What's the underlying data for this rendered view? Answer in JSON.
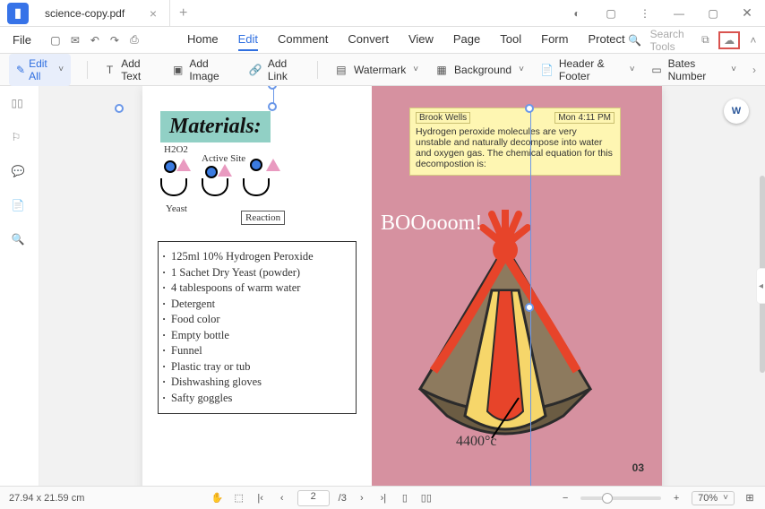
{
  "app": {
    "tab_name": "science-copy.pdf"
  },
  "menubar": {
    "file": "File",
    "items": [
      "Home",
      "Edit",
      "Comment",
      "Convert",
      "View",
      "Page",
      "Tool",
      "Form",
      "Protect"
    ],
    "active": "Edit",
    "search_placeholder": "Search Tools"
  },
  "toolbar": {
    "edit_all": "Edit All",
    "add_text": "Add Text",
    "add_image": "Add Image",
    "add_link": "Add Link",
    "watermark": "Watermark",
    "background": "Background",
    "header_footer": "Header & Footer",
    "bates_number": "Bates Number"
  },
  "document": {
    "materials_heading": "Materials:",
    "diagram": {
      "h2o2": "H2O2",
      "active_site": "Active Site",
      "yeast": "Yeast",
      "reaction": "Reaction"
    },
    "materials_list": [
      "125ml 10% Hydrogen Peroxide",
      "1 Sachet Dry Yeast (powder)",
      "4 tablespoons of warm water",
      "Detergent",
      "Food color",
      "Empty bottle",
      "Funnel",
      "Plastic tray or tub",
      "Dishwashing gloves",
      "Safty goggles"
    ],
    "sticky": {
      "author": "Brook Wells",
      "timestamp": "Mon 4:11 PM",
      "body": "Hydrogen peroxide molecules are very unstable and naturally decompose into water and oxygen gas. The chemical equation for this decompostion is:"
    },
    "booom": "BOOooom!",
    "temperature": "4400°c",
    "page_number": "03"
  },
  "statusbar": {
    "dimensions": "27.94 x 21.59 cm",
    "page_current": "2",
    "page_total": "/3",
    "zoom": "70%"
  }
}
